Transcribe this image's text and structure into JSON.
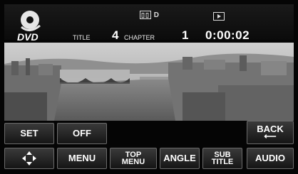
{
  "header": {
    "media_logo": "DVD",
    "format_logo": "D",
    "title_label": "TITLE",
    "title_value": "4",
    "chapter_label": "CHAPTER",
    "chapter_value": "1",
    "elapsed_time": "0:00:02",
    "play_icon": "play-status-icon"
  },
  "controls": {
    "set": "SET",
    "off": "OFF",
    "back": "BACK",
    "move": "cursor-move-icon",
    "menu": "MENU",
    "top_menu": "TOP\nMENU",
    "angle": "ANGLE",
    "sub_title": "SUB\nTITLE",
    "audio": "AUDIO"
  },
  "colors": {
    "background": "#050505",
    "button_border": "#6b6b6b",
    "text": "#ffffff"
  }
}
